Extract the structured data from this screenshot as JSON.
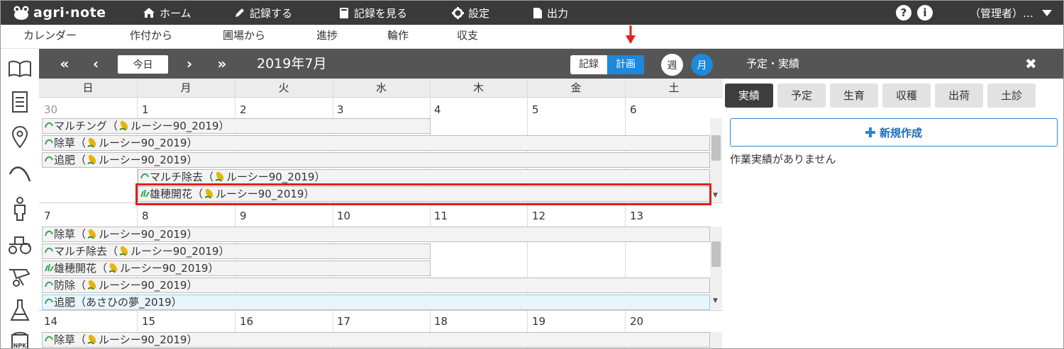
{
  "app": {
    "name": "agri·note"
  },
  "topnav": [
    {
      "label": "ホーム",
      "icon": "home-icon"
    },
    {
      "label": "記録する",
      "icon": "pencil-icon"
    },
    {
      "label": "記録を見る",
      "icon": "book-icon"
    },
    {
      "label": "設定",
      "icon": "gear-icon"
    },
    {
      "label": "出力",
      "icon": "document-icon"
    }
  ],
  "user": {
    "label": "（管理者）…"
  },
  "subnav": [
    "カレンダー",
    "作付から",
    "圃場から",
    "進捗",
    "輪作",
    "収支"
  ],
  "toolbar": {
    "prev_year": "«",
    "prev": "‹",
    "today": "今日",
    "next": "›",
    "next_year": "»",
    "title": "2019年7月",
    "record": "記録",
    "plan": "計画",
    "week": "週",
    "month": "月"
  },
  "weekdays": [
    "日",
    "月",
    "火",
    "水",
    "木",
    "金",
    "土"
  ],
  "weeks": [
    {
      "dates": [
        "30",
        "1",
        "2",
        "3",
        "4",
        "5",
        "6"
      ],
      "events": [
        "マルチング（",
        "ルーシー90_2019）",
        "除草（",
        "ルーシー90_2019）",
        "追肥（",
        "ルーシー90_2019）",
        "マルチ除去（",
        "ルーシー90_2019）",
        "雄穂開花（",
        "ルーシー90_2019）"
      ]
    },
    {
      "dates": [
        "7",
        "8",
        "9",
        "10",
        "11",
        "12",
        "13"
      ],
      "events": [
        "除草（",
        "ルーシー90_2019）",
        "マルチ除去（",
        "ルーシー90_2019）",
        "雄穂開花（",
        "ルーシー90_2019）",
        "防除（",
        "ルーシー90_2019）",
        "追肥（あさひの夢_2019）"
      ]
    },
    {
      "dates": [
        "14",
        "15",
        "16",
        "17",
        "18",
        "19",
        "20"
      ],
      "events": [
        "除草（",
        "ルーシー90_2019）"
      ]
    }
  ],
  "panel": {
    "title": "予定・実績",
    "close": "✖",
    "tabs": [
      "実績",
      "予定",
      "生育",
      "収穫",
      "出荷",
      "土診"
    ],
    "new_button": "新規作成",
    "empty": "作業実績がありません"
  },
  "colors": {
    "topbar": "#3a3a3a",
    "toolbar": "#555555",
    "accent": "#1e88d9",
    "highlight": "#e02020"
  }
}
